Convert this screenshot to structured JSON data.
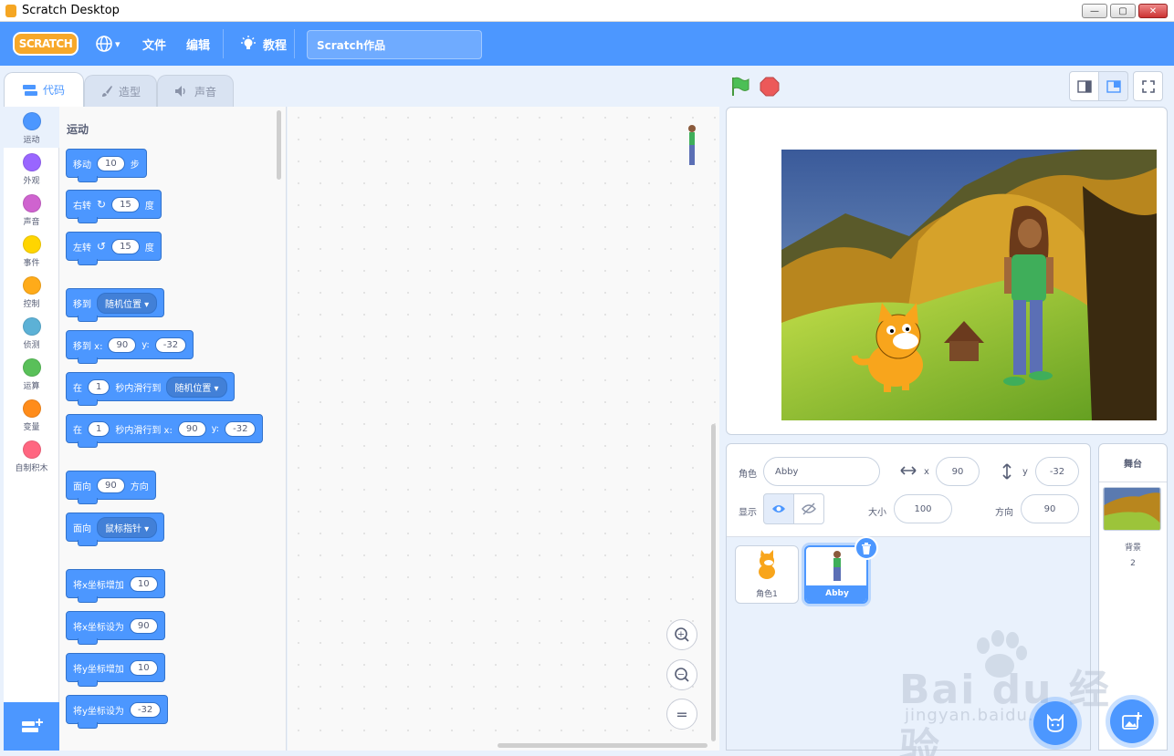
{
  "window": {
    "title": "Scratch Desktop",
    "min": "—",
    "max": "▢",
    "close": "✕"
  },
  "menubar": {
    "logo": "SCRATCH",
    "file": "文件",
    "edit": "编辑",
    "tutorials": "教程",
    "project_title": "Scratch作品",
    "globe_caret": "▾"
  },
  "tabs": {
    "code": "代码",
    "costumes": "造型",
    "sounds": "声音"
  },
  "categories": [
    {
      "label": "运动",
      "color": "#4c97ff"
    },
    {
      "label": "外观",
      "color": "#9966ff"
    },
    {
      "label": "声音",
      "color": "#cf63cf"
    },
    {
      "label": "事件",
      "color": "#ffd500"
    },
    {
      "label": "控制",
      "color": "#ffab19"
    },
    {
      "label": "侦测",
      "color": "#5cb1d6"
    },
    {
      "label": "运算",
      "color": "#59c059"
    },
    {
      "label": "变量",
      "color": "#ff8c1a"
    },
    {
      "label": "自制积木",
      "color": "#ff6680"
    }
  ],
  "palette": {
    "heading": "运动",
    "move": {
      "a": "移动",
      "v": "10",
      "b": "步"
    },
    "turn_right": {
      "a": "右转",
      "v": "15",
      "b": "度"
    },
    "turn_left": {
      "a": "左转",
      "v": "15",
      "b": "度"
    },
    "goto": {
      "a": "移到",
      "d": "随机位置"
    },
    "goto_xy": {
      "a": "移到 x:",
      "x": "90",
      "b": "y:",
      "y": "-32"
    },
    "glide": {
      "a": "在",
      "v": "1",
      "b": "秒内滑行到",
      "d": "随机位置"
    },
    "glide_xy": {
      "a": "在",
      "v": "1",
      "b": "秒内滑行到 x:",
      "x": "90",
      "c": "y:",
      "y": "-32"
    },
    "point_dir": {
      "a": "面向",
      "v": "90",
      "b": "方向"
    },
    "point_towards": {
      "a": "面向",
      "d": "鼠标指针"
    },
    "change_x": {
      "a": "将x坐标增加",
      "v": "10"
    },
    "set_x": {
      "a": "将x坐标设为",
      "v": "90"
    },
    "change_y": {
      "a": "将y坐标增加",
      "v": "10"
    },
    "set_y": {
      "a": "将y坐标设为",
      "v": "-32"
    }
  },
  "zoom": {
    "in": "+",
    "out": "−",
    "reset": "="
  },
  "sprite_info": {
    "sprite_label": "角色",
    "sprite_name": "Abby",
    "x_label": "x",
    "x": "90",
    "y_label": "y",
    "y": "-32",
    "show_label": "显示",
    "size_label": "大小",
    "size": "100",
    "direction_label": "方向",
    "direction": "90"
  },
  "sprites": [
    {
      "name": "角色1"
    },
    {
      "name": "Abby"
    }
  ],
  "stage_pane": {
    "title": "舞台",
    "backdrop_label": "背景",
    "backdrop_count": "2"
  },
  "watermark": {
    "brand": "Bai du 经验",
    "url": "jingyan.baidu.com"
  },
  "colors": {
    "accent": "#4c97ff",
    "motion": "#4c97ff",
    "menubar": "#4c97ff",
    "flag": "#4cbf56",
    "stop": "#ec5959"
  }
}
